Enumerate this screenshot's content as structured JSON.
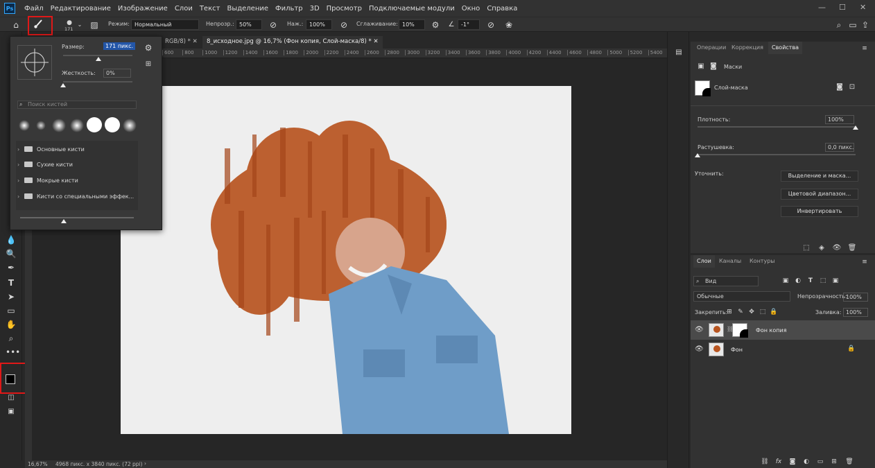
{
  "app": {
    "logo": "Ps"
  },
  "menu": [
    "Файл",
    "Редактирование",
    "Изображение",
    "Слои",
    "Текст",
    "Выделение",
    "Фильтр",
    "3D",
    "Просмотр",
    "Подключаемые модули",
    "Окно",
    "Справка"
  ],
  "window_controls": {
    "minimize": "—",
    "maximize": "☐",
    "close": "✕"
  },
  "options": {
    "brush_size": "171",
    "mode_label": "Режим:",
    "mode_value": "Нормальный",
    "opacity_label": "Непрозр.:",
    "opacity_value": "50%",
    "pressure_label": "Наж.:",
    "pressure_value": "100%",
    "smoothing_label": "Сглаживание:",
    "smoothing_value": "10%",
    "angle_value": "-1°"
  },
  "brush_popup": {
    "size_label": "Размер:",
    "size_value": "171 пикс.",
    "hardness_label": "Жесткость:",
    "hardness_value": "0%",
    "size_fraction": 0.51,
    "hardness_fraction": 0.0,
    "search_placeholder": "Поиск кистей",
    "folders": [
      "Основные кисти",
      "Сухие кисти",
      "Мокрые кисти",
      "Кисти со специальными эффек..."
    ]
  },
  "tabs": {
    "partial": "RGB/8) *",
    "active": "8_исходное.jpg @ 16,7% (Фон копия, Слой-маска/8) *"
  },
  "ruler_ticks": [
    "600",
    "800",
    "1000",
    "1200",
    "1400",
    "1600",
    "1800",
    "2000",
    "2200",
    "2400",
    "2600",
    "2800",
    "3000",
    "3200",
    "3400",
    "3600",
    "3800",
    "4000",
    "4200",
    "4400",
    "4600",
    "4800",
    "5000",
    "5200",
    "5400"
  ],
  "status": {
    "zoom": "16,67%",
    "doc_size": "4968 пикс. x 3840 пикс. (72 ppi)"
  },
  "properties_panel": {
    "tabs": [
      "Операции",
      "Коррекция",
      "Свойства"
    ],
    "masks_label": "Маски",
    "mask_name": "Слой-маска",
    "density_label": "Плотность:",
    "density_value": "100%",
    "feather_label": "Растушевка:",
    "feather_value": "0,0 пикс.",
    "density_fraction": 1.0,
    "feather_fraction": 0.0,
    "refine_label": "Уточнить:",
    "buttons": [
      "Выделение и маска...",
      "Цветовой диапазон...",
      "Инвертировать"
    ]
  },
  "layers_panel": {
    "tabs": [
      "Слои",
      "Каналы",
      "Контуры"
    ],
    "filter_label": "Вид",
    "blend_mode": "Обычные",
    "opacity_label": "Непрозрачность:",
    "opacity_value": "100%",
    "lock_label": "Закрепить:",
    "fill_label": "Заливка:",
    "fill_value": "100%",
    "layers": [
      {
        "name": "Фон копия"
      },
      {
        "name": "Фон"
      }
    ]
  },
  "colors": {
    "accent": "#31a8ff",
    "highlight_box": "#e01818",
    "hair": "#b85520",
    "denim": "#6f9dc8"
  }
}
